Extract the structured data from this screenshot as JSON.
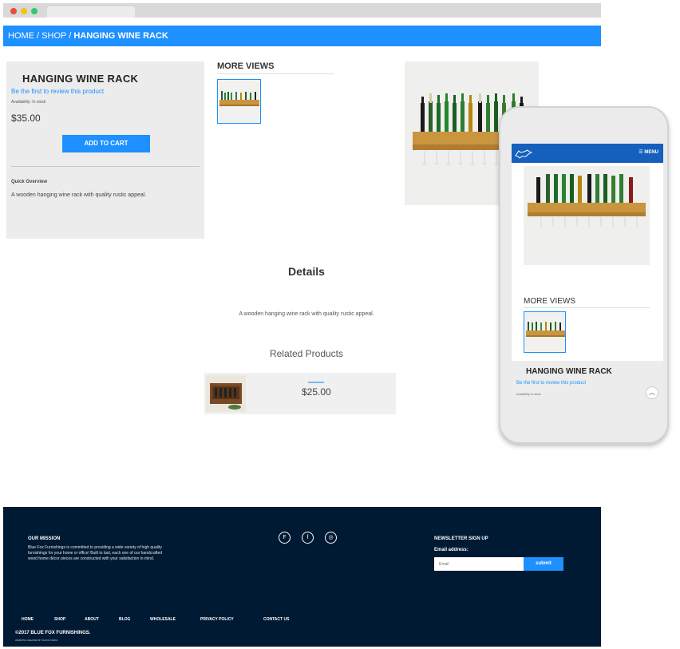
{
  "breadcrumb": {
    "home": "HOME",
    "sep1": " / ",
    "shop": "SHOP",
    "sep2": " / ",
    "current": "HANGING WINE RACK"
  },
  "product": {
    "title": "HANGING WINE RACK",
    "review_link": "Be the first to review this product",
    "availability": "Availability: In stock",
    "price": "$35.00",
    "add_to_cart": "ADD TO CART",
    "overview_label": "Quick Overview",
    "overview_text": "A wooden hanging wine rack with quality rustic appeal."
  },
  "more_views": {
    "title": "MORE VIEWS"
  },
  "details": {
    "title": "Details",
    "text": "A wooden hanging wine rack with quality rustic appeal."
  },
  "related": {
    "title": "Related Products",
    "price": "$25.00"
  },
  "footer": {
    "mission_title": "OUR MISSION",
    "mission_text": "Blue Fox Furnishings is committed to providing a wide variety of high quality furnishings for your home or office! Built to last, each one of our handcrafted wood home décor pieces are constructed with your satisfaction in mind.",
    "social": [
      "f-circle-icon",
      "facebook-icon",
      "instagram-icon"
    ],
    "newsletter_title": "NEWSLETTER SIGN UP",
    "email_label": "Email address:",
    "email_placeholder": "Email",
    "submit": "submit",
    "nav": [
      "HOME",
      "SHOP",
      "ABOUT",
      "BLOG",
      "WHOLESALE",
      "PRIVACY POLICY",
      "CONTACT US"
    ],
    "copyright": "©2017 BLUE FOX FURNISHINGS.",
    "credit": "WEBSITE CREATED BY DAVID KORDI"
  },
  "mobile": {
    "menu": "☰ MENU",
    "more_views_title": "MORE VIEWS",
    "product_title": "HANGING WINE RACK",
    "review_link": "Be the first to review this product",
    "availability": "Availability: In stock"
  },
  "colors": {
    "accent": "#1e90ff",
    "footer_bg": "#001a33",
    "panel_bg": "#ececec",
    "mobile_header": "#1560bd"
  }
}
